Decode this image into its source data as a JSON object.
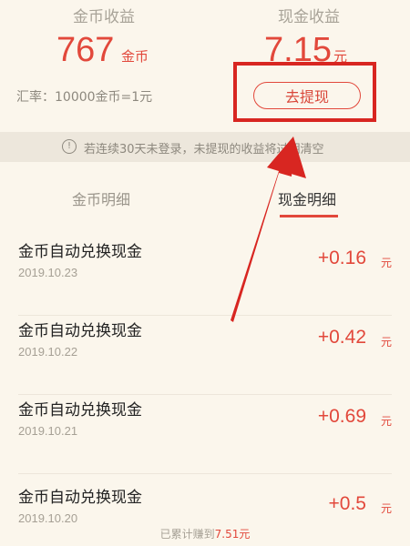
{
  "header": {
    "coin_label": "金币收益",
    "cash_label": "现金收益",
    "coin_value": "767",
    "coin_unit": "金币",
    "cash_value": "7.15",
    "cash_unit": "元",
    "rate": "汇率：10000金币=1元",
    "withdraw_button": "去提现"
  },
  "notice": {
    "icon": "info-icon",
    "text": "若连续30天未登录，未提现的收益将过期清空"
  },
  "tabs": [
    {
      "label": "金币明细",
      "active": false
    },
    {
      "label": "现金明细",
      "active": true
    }
  ],
  "records": [
    {
      "title": "金币自动兑换现金",
      "date": "2019.10.23",
      "amount": "+0.16",
      "unit": "元"
    },
    {
      "title": "金币自动兑换现金",
      "date": "2019.10.22",
      "amount": "+0.42",
      "unit": "元"
    },
    {
      "title": "金币自动兑换现金",
      "date": "2019.10.21",
      "amount": "+0.69",
      "unit": "元"
    },
    {
      "title": "金币自动兑换现金",
      "date": "2019.10.20",
      "amount": "+0.5",
      "unit": "元"
    }
  ],
  "footer": {
    "prefix": "已累计赚到",
    "amount": "7.51元"
  },
  "colors": {
    "accent": "#e2483b",
    "annotation": "#d82621",
    "background": "#fbf6ec"
  }
}
